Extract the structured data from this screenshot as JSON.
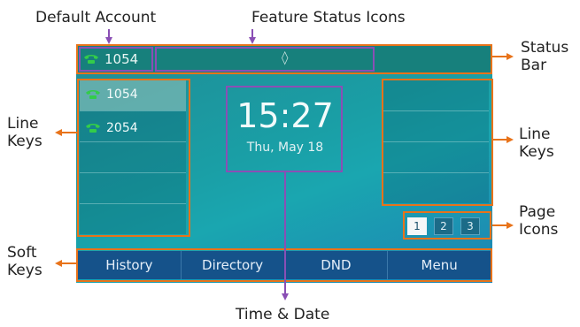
{
  "callouts": {
    "default_account": "Default Account",
    "feature_status_icons": "Feature Status Icons",
    "status_bar_1": "Status",
    "status_bar_2": "Bar",
    "line_keys_left_1": "Line",
    "line_keys_left_2": "Keys",
    "line_keys_right_1": "Line",
    "line_keys_right_2": "Keys",
    "page_icons_1": "Page",
    "page_icons_2": "Icons",
    "soft_keys_1": "Soft",
    "soft_keys_2": "Keys",
    "time_date": "Time & Date"
  },
  "screen": {
    "status_bar": {
      "account": "1054",
      "feature_icons": [
        "bluetooth-icon"
      ]
    },
    "line_keys_left": [
      "1054",
      "2054"
    ],
    "clock": {
      "time": "15:27",
      "date": "Thu, May 18"
    },
    "page_icons": [
      "1",
      "2",
      "3"
    ],
    "active_page": "1",
    "soft_keys": [
      "History",
      "Directory",
      "DND",
      "Menu"
    ]
  },
  "colors": {
    "callout_arrow_orange": "#e8731a",
    "callout_arrow_purple": "#8a4fb5",
    "status_bar": "#17807c",
    "soft_key_bar": "#15528a",
    "phone_icon_green": "#33cc4a"
  }
}
